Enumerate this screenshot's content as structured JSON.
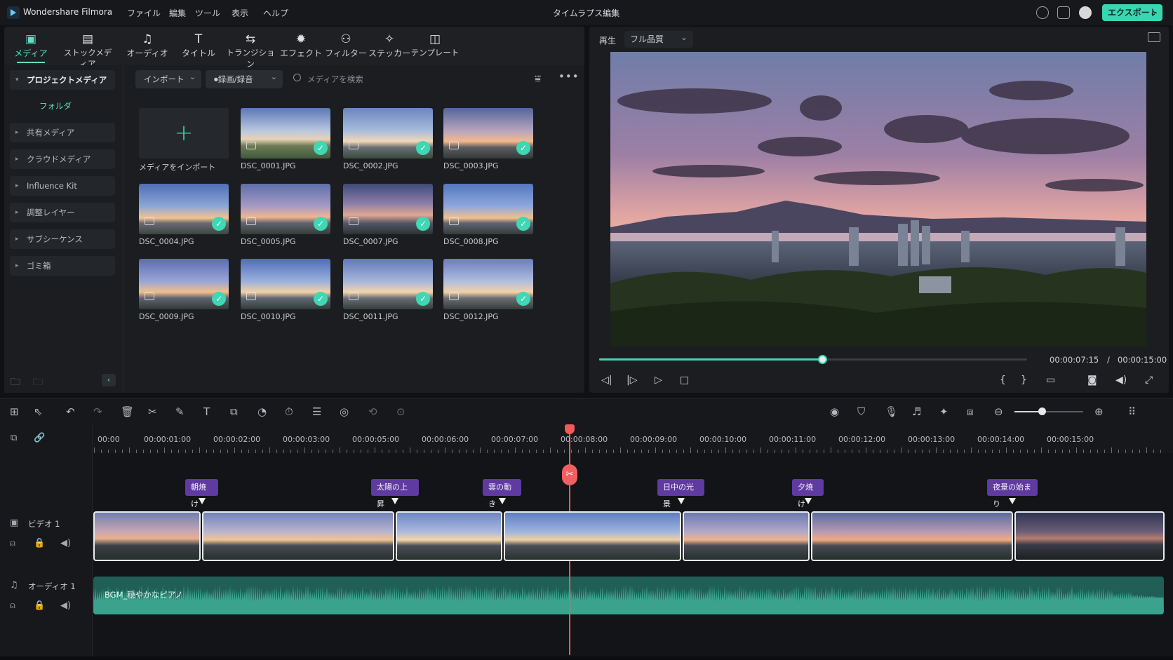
{
  "app": {
    "name": "Wondershare Filmora",
    "window_title": "タイムラプス編集",
    "export_label": "エクスポート"
  },
  "menu": [
    "ファイル",
    "編集",
    "ツール",
    "表示",
    "ヘルプ"
  ],
  "tools": [
    {
      "label": "メディア",
      "icon": "media-icon"
    },
    {
      "label": "ストックメディア",
      "icon": "stock-media-icon"
    },
    {
      "label": "オーディオ",
      "icon": "music-note-icon"
    },
    {
      "label": "タイトル",
      "icon": "title-icon"
    },
    {
      "label": "トランジション",
      "icon": "transition-icon"
    },
    {
      "label": "エフェクト",
      "icon": "effect-icon"
    },
    {
      "label": "フィルター",
      "icon": "filter-icon"
    },
    {
      "label": "ステッカー",
      "icon": "sticker-icon"
    },
    {
      "label": "テンプレート",
      "icon": "template-icon"
    }
  ],
  "sidebar": {
    "project": "プロジェクトメディア",
    "folder": "フォルダ",
    "items": [
      "共有メディア",
      "クラウドメディア",
      "Influence Kit",
      "調整レイヤー",
      "サブシーケンス",
      "ゴミ箱"
    ]
  },
  "media_toolbar": {
    "import": "インポート",
    "record": "録画/録音",
    "search_placeholder": "メディアを検索"
  },
  "media": {
    "import_tile": "メディアをインポート",
    "files": [
      "DSC_0001.JPG",
      "DSC_0002.JPG",
      "DSC_0003.JPG",
      "DSC_0004.JPG",
      "DSC_0005.JPG",
      "DSC_0007.JPG",
      "DSC_0008.JPG",
      "DSC_0009.JPG",
      "DSC_0010.JPG",
      "DSC_0011.JPG",
      "DSC_0012.JPG"
    ]
  },
  "preview": {
    "play_label": "再生",
    "quality": "フル品質",
    "current_time": "00:00:07:15",
    "separator": "/",
    "total_time": "00:00:15:00",
    "progress": 0.5
  },
  "timeline": {
    "ruler": [
      "00:00",
      "00:00:01:00",
      "00:00:02:00",
      "00:00:03:00",
      "00:00:05:00",
      "00:00:06:00",
      "00:00:07:00",
      "00:00:08:00",
      "00:00:09:00",
      "00:00:10:00",
      "00:00:11:00",
      "00:00:12:00",
      "00:00:13:00",
      "00:00:14:00",
      "00:00:15:00"
    ],
    "markers": [
      "朝焼け",
      "太陽の上昇",
      "雲の動き",
      "日中の光景",
      "夕焼け",
      "夜景の始まり"
    ],
    "video_track": "ビデオ 1",
    "audio_track": "オーディオ 1",
    "audio_clip": "BGM_穏やかなピアノ"
  },
  "colors": {
    "accent": "#3fd7b4",
    "playhead": "#f05a5a",
    "marker": "#5f3aa0"
  }
}
